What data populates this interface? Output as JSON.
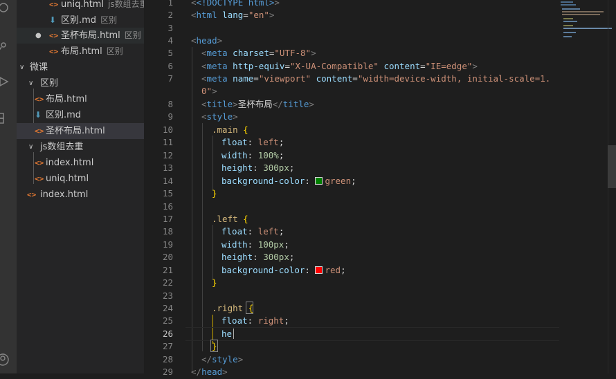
{
  "explorer": {
    "items": [
      {
        "kind": "html",
        "label": "uniq.html",
        "desc": "js数组去重"
      },
      {
        "kind": "md",
        "label": "区别.md",
        "desc": "区别"
      },
      {
        "kind": "html",
        "label": "圣杯布局.html",
        "desc": "区别",
        "modified": true
      },
      {
        "kind": "html",
        "label": "布局.html",
        "desc": "区别"
      },
      {
        "kind": "folder",
        "label": "微课"
      },
      {
        "kind": "folder",
        "label": "区别"
      },
      {
        "kind": "html",
        "label": "布局.html"
      },
      {
        "kind": "md",
        "label": "区别.md"
      },
      {
        "kind": "html",
        "label": "圣杯布局.html"
      },
      {
        "kind": "folder",
        "label": "js数组去重"
      },
      {
        "kind": "html",
        "label": "index.html"
      },
      {
        "kind": "html",
        "label": "uniq.html"
      },
      {
        "kind": "html",
        "label": "index.html"
      }
    ]
  },
  "editor": {
    "active_line": "26",
    "lines": [
      {
        "n": "1"
      },
      {
        "n": "2"
      },
      {
        "n": "3"
      },
      {
        "n": "4"
      },
      {
        "n": "5"
      },
      {
        "n": "6"
      },
      {
        "n": "7"
      },
      {
        "n": ""
      },
      {
        "n": "8"
      },
      {
        "n": "9"
      },
      {
        "n": "10"
      },
      {
        "n": "11"
      },
      {
        "n": "12"
      },
      {
        "n": "13"
      },
      {
        "n": "14"
      },
      {
        "n": "15"
      },
      {
        "n": "16"
      },
      {
        "n": "17"
      },
      {
        "n": "18"
      },
      {
        "n": "19"
      },
      {
        "n": "20"
      },
      {
        "n": "21"
      },
      {
        "n": "22"
      },
      {
        "n": "23"
      },
      {
        "n": "24"
      },
      {
        "n": "25"
      },
      {
        "n": "26"
      },
      {
        "n": "27"
      },
      {
        "n": "28"
      },
      {
        "n": "29"
      }
    ],
    "code": {
      "l1_a": "<!DOCTYPE html>",
      "l2_tag": "html",
      "l2_attr": "lang",
      "l2_val": "\"en\"",
      "l4_tag": "head",
      "l5_tag": "meta",
      "l5_attr": "charset",
      "l5_val": "\"UTF-8\"",
      "l6_tag": "meta",
      "l6_attr1": "http-equiv",
      "l6_val1": "\"X-UA-Compatible\"",
      "l6_attr2": "content",
      "l6_val2": "\"IE=edge\"",
      "l7_tag": "meta",
      "l7_attr1": "name",
      "l7_val1": "\"viewport\"",
      "l7_attr2": "content",
      "l7_val2": "\"width=device-width, initial-scale=1.",
      "l7b_val": "0\"",
      "l8_tag": "title",
      "l8_text": "圣杯布局",
      "l8_close": "title",
      "l9_tag": "style",
      "l10_sel": ".main",
      "l11_prop": "float",
      "l11_val": "left",
      "l12_prop": "width",
      "l12_val": "100%",
      "l13_prop": "height",
      "l13_val": "300px",
      "l14_prop": "background-color",
      "l14_val": "green",
      "l14_color": "#008000",
      "l17_sel": ".left",
      "l18_prop": "float",
      "l18_val": "left",
      "l19_prop": "width",
      "l19_val": "100px",
      "l20_prop": "height",
      "l20_val": "300px",
      "l21_prop": "background-color",
      "l21_val": "red",
      "l21_color": "#ff0000",
      "l24_sel": ".right",
      "l25_prop": "float",
      "l25_val": "right",
      "l26_text": "he",
      "l28_tag": "style",
      "l29_tag": "head"
    }
  }
}
